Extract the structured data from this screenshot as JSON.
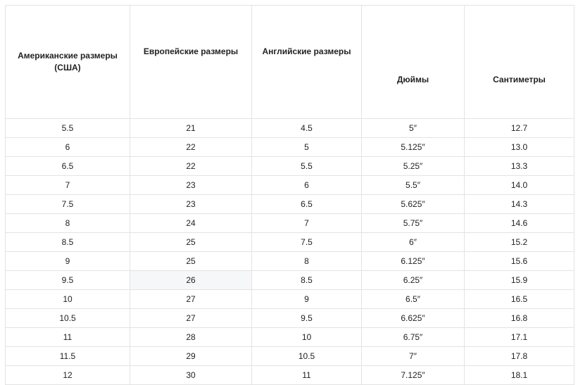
{
  "table": {
    "headers": [
      "Американские размеры (США)",
      "Европейские размеры",
      "Английские размеры",
      "Дюймы",
      "Сантиметры"
    ],
    "rows": [
      [
        "5.5",
        "21",
        "4.5",
        "5″",
        "12.7"
      ],
      [
        "6",
        "22",
        "5",
        "5.125″",
        "13.0"
      ],
      [
        "6.5",
        "22",
        "5.5",
        "5.25″",
        "13.3"
      ],
      [
        "7",
        "23",
        "6",
        "5.5″",
        "14.0"
      ],
      [
        "7.5",
        "23",
        "6.5",
        "5.625″",
        "14.3"
      ],
      [
        "8",
        "24",
        "7",
        "5.75″",
        "14.6"
      ],
      [
        "8.5",
        "25",
        "7.5",
        "6″",
        "15.2"
      ],
      [
        "9",
        "25",
        "8",
        "6.125″",
        "15.6"
      ],
      [
        "9.5",
        "26",
        "8.5",
        "6.25″",
        "15.9"
      ],
      [
        "10",
        "27",
        "9",
        "6.5″",
        "16.5"
      ],
      [
        "10.5",
        "27",
        "9.5",
        "6.625″",
        "16.8"
      ],
      [
        "11",
        "28",
        "10",
        "6.75″",
        "17.1"
      ],
      [
        "11.5",
        "29",
        "10.5",
        "7″",
        "17.8"
      ],
      [
        "12",
        "30",
        "11",
        "7.125″",
        "18.1"
      ]
    ],
    "highlighted_cell": {
      "row": 8,
      "col": 1
    },
    "colors": {
      "border": "#e3e3e3",
      "text": "#222222",
      "highlight": "#f6f7f8",
      "background": "#ffffff"
    }
  }
}
